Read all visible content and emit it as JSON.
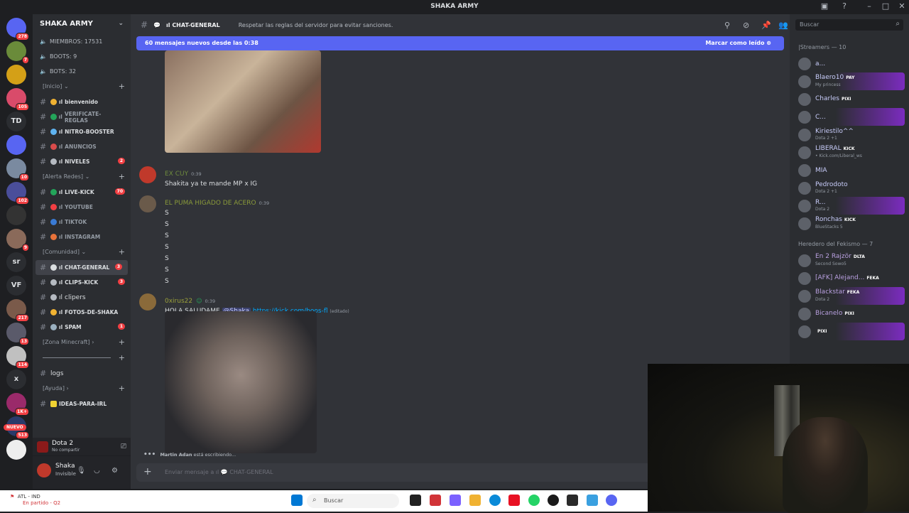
{
  "window": {
    "title": "SHAKA ARMY"
  },
  "guilds": [
    {
      "label": "",
      "badge": "278",
      "color": "#5865f2"
    },
    {
      "label": "",
      "badge": "7",
      "color": "#6a8b3a"
    },
    {
      "label": "",
      "badge": "",
      "color": "#d4a017"
    },
    {
      "label": "",
      "badge": "105",
      "color": "#d94b6a"
    },
    {
      "label": "TD",
      "badge": "",
      "color": "#2b2d31"
    },
    {
      "label": "",
      "badge": "",
      "color": "#5865f2"
    },
    {
      "label": "",
      "badge": "10",
      "color": "#7a8aa0"
    },
    {
      "label": "",
      "badge": "102",
      "color": "#4a4e9a"
    },
    {
      "label": "",
      "badge": "",
      "color": "#333333"
    },
    {
      "label": "",
      "badge": "9",
      "color": "#8a6a5a"
    },
    {
      "label": "sr",
      "badge": "",
      "color": "#2b2d31"
    },
    {
      "label": "VF",
      "badge": "",
      "color": "#2b2d31"
    },
    {
      "label": "",
      "badge": "217",
      "color": "#7a5a4a"
    },
    {
      "label": "",
      "badge": "13",
      "color": "#5a5a6a"
    },
    {
      "label": "",
      "badge": "114",
      "color": "#c0c0c0"
    },
    {
      "label": "x",
      "badge": "",
      "color": "#2b2d31"
    },
    {
      "label": "",
      "badge": "1K+",
      "color": "#9a2a6a"
    },
    {
      "label": "",
      "badge": "513",
      "color": "#2a3a6a"
    },
    {
      "label": "",
      "badge": "",
      "color": "#eeeeee"
    }
  ],
  "guild_nuevo": "NUEVO",
  "server": {
    "name": "SHAKA ARMY",
    "stats": [
      "MIEMBROS: 17531",
      "BOOTS: 9",
      "BOTS: 32"
    ],
    "categories": [
      {
        "label": "[Inicio]",
        "channels": [
          {
            "name": "bienvenido",
            "prefix": "ıl",
            "color": "#f0b232",
            "badge": ""
          },
          {
            "name": "VERIFICATE-REGLAS",
            "prefix": "ıl",
            "color": "#23a55a",
            "badge": "",
            "dim": true
          },
          {
            "name": "NITRO-BOOSTER",
            "prefix": "ıl",
            "color": "#5fb3f0",
            "badge": ""
          },
          {
            "name": "ANUNCIOS",
            "prefix": "ıl",
            "color": "#d94b4b",
            "badge": "",
            "dim": true
          },
          {
            "name": "NIVELES",
            "prefix": "ıl",
            "color": "#b5bac1",
            "badge": "2"
          }
        ]
      },
      {
        "label": "[Alerta Redes]",
        "channels": [
          {
            "name": "LIVE-KICK",
            "prefix": "ıl",
            "color": "#23a55a",
            "badge": "70"
          },
          {
            "name": "YOUTUBE",
            "prefix": "ıl",
            "color": "#f23f43",
            "badge": "",
            "dim": true
          },
          {
            "name": "TIKTOK",
            "prefix": "ıl",
            "color": "#3a7bd5",
            "badge": "",
            "dim": true
          },
          {
            "name": "INSTAGRAM",
            "prefix": "ıl",
            "color": "#e8723a",
            "badge": "",
            "dim": true
          }
        ]
      },
      {
        "label": "[Comunidad]",
        "channels": [
          {
            "name": "CHAT-GENERAL",
            "prefix": "ıl",
            "color": "#dbdee1",
            "badge": "3",
            "active": true
          },
          {
            "name": "CLIPS-KICK",
            "prefix": "ıl",
            "color": "#b5bac1",
            "badge": "3"
          },
          {
            "name": "clipers",
            "prefix": "ıl",
            "color": "#b5bac1",
            "badge": "",
            "plain": true
          },
          {
            "name": "FOTOS-DE-SHAKA",
            "prefix": "ıl",
            "color": "#f0b232",
            "badge": ""
          },
          {
            "name": "SPAM",
            "prefix": "ıl",
            "color": "#9ab0c0",
            "badge": "1"
          }
        ]
      }
    ],
    "zona_minecraft": "[Zona Minecraft]",
    "separator_label": "",
    "logs": "logs",
    "ayuda": "[Ayuda]",
    "ideas": "IDEAS-PARA-IRL"
  },
  "activity": {
    "game": "Dota 2",
    "sub": "No compartir"
  },
  "user": {
    "name": "Shaka",
    "status": "Invisible"
  },
  "chat": {
    "channel": "CHAT-GENERAL",
    "prefix": "ıl",
    "topic": "Respetar las reglas del servidor para evitar sanciones.",
    "new_messages": "60 mensajes nuevos desde las 0:38",
    "mark_read": "Marcar como leído",
    "messages": [
      {
        "author": "EX CUY",
        "color": "#6e8b3d",
        "time": "0:39",
        "lines": [
          "Shakita ya te mande MP x IG"
        ]
      },
      {
        "author": "EL PUMA HIGADO DE ACERO",
        "color": "#8a9a3a",
        "time": "0:39",
        "lines": [
          "S",
          "S",
          "S",
          "S",
          "S",
          "S",
          "S"
        ]
      },
      {
        "author": "0xirus22",
        "color": "#9aa03a",
        "time": "0:39",
        "text": "HOLA SALUDAME ",
        "mention": "@Shaka",
        "link": "https://kick.com/boos-fl",
        "edited": "(editado)"
      }
    ],
    "typing_user": "Martin Adan",
    "typing_suffix": " está escribiendo...",
    "composer_placeholder": "Enviar mensaje a ıl",
    "composer_channel": "CHAT-GENERAL"
  },
  "members": {
    "search_placeholder": "Buscar",
    "groups": [
      {
        "label": "|Streamers — 10",
        "items": [
          {
            "name": "a...",
            "color": "#c9cdfb",
            "sub": "",
            "tag": "",
            "boost": false
          },
          {
            "name": "Blaero10",
            "color": "#c9cdfb",
            "sub": "My princess",
            "tag": "PAY",
            "boost": true
          },
          {
            "name": "Charles",
            "color": "#c9cdfb",
            "sub": "",
            "tag": "PIXI",
            "boost": false
          },
          {
            "name": "C...",
            "color": "#c9cdfb",
            "sub": "",
            "tag": "",
            "boost": true
          },
          {
            "name": "Kiriestilo^^",
            "color": "#c9cdfb",
            "sub": "Dota 2 +1",
            "tag": "",
            "boost": false
          },
          {
            "name": "LIBERAL",
            "color": "#c9cdfb",
            "sub": "• Kick.com/Liberal_ws",
            "tag": "KICK",
            "boost": false
          },
          {
            "name": "MIA",
            "color": "#c9cdfb",
            "sub": "",
            "tag": "",
            "boost": false
          },
          {
            "name": "Pedrodoto",
            "color": "#c9cdfb",
            "sub": "Dota 2 +1",
            "tag": "",
            "boost": false
          },
          {
            "name": "R...",
            "color": "#c9cdfb",
            "sub": "Dota 2",
            "tag": "",
            "boost": true
          },
          {
            "name": "Ronchas",
            "color": "#c9cdfb",
            "sub": "BlueStacks 5",
            "tag": "KICK",
            "boost": false
          }
        ]
      },
      {
        "label": "Heredero del Fekismo — 7",
        "items": [
          {
            "name": "En 2 Rajzör",
            "color": "#b9a0e0",
            "sub": "Second Sowo5",
            "tag": "DLTA",
            "boost": false
          },
          {
            "name": "[AFK] Alejand...",
            "color": "#b9a0e0",
            "sub": "",
            "tag": "FEKA",
            "boost": false
          },
          {
            "name": "Blackstar",
            "color": "#b9a0e0",
            "sub": "Dota 2",
            "tag": "FEKA",
            "boost": true
          },
          {
            "name": "Bicanelo",
            "color": "#b9a0e0",
            "sub": "",
            "tag": "PIXI",
            "boost": false
          },
          {
            "name": "",
            "color": "#b9a0e0",
            "sub": "",
            "tag": "PIXI",
            "boost": true
          }
        ]
      }
    ]
  },
  "taskbar": {
    "weather": "ATL - IND",
    "weather_sub": "En partido - Q2",
    "search": "Buscar"
  }
}
